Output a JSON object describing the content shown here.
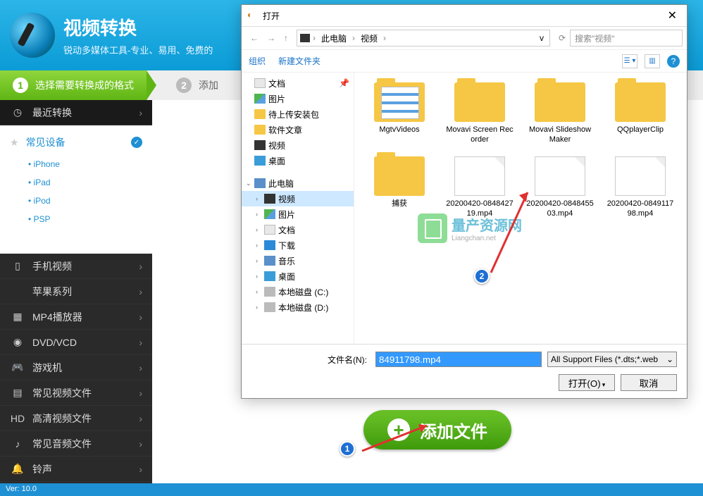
{
  "header": {
    "title": "视频转换",
    "subtitle": "锐动多媒体工具-专业、易用、免费的"
  },
  "steps": {
    "s1": "选择需要转换成的格式",
    "s2": "添加"
  },
  "sidebar": {
    "recent": "最近转换",
    "common_devices": "常见设备",
    "devices": [
      "iPhone",
      "iPad",
      "iPod",
      "PSP"
    ],
    "cats": [
      "手机视频",
      "苹果系列",
      "MP4播放器",
      "DVD/VCD",
      "游戏机",
      "常见视频文件",
      "高清视频文件",
      "常见音频文件",
      "铃声"
    ]
  },
  "addfile": "添加文件",
  "version": "Ver: 10.0",
  "dialog": {
    "title": "打开",
    "crumb_pc": "此电脑",
    "crumb_vid": "视频",
    "search_ph": "搜索\"视频\"",
    "organize": "组织",
    "newfolder": "新建文件夹",
    "tree_quick": [
      "文档",
      "图片",
      "待上传安装包",
      "软件文章",
      "视频",
      "桌面"
    ],
    "tree_pc": "此电脑",
    "tree_pcitems": [
      "视频",
      "图片",
      "文档",
      "下载",
      "音乐",
      "桌面",
      "本地磁盘 (C:)",
      "本地磁盘 (D:)"
    ],
    "files": [
      {
        "name": "MgtvVideos",
        "type": "folder-film"
      },
      {
        "name": "Movavi Screen Recorder",
        "type": "folder"
      },
      {
        "name": "Movavi Slideshow Maker",
        "type": "folder"
      },
      {
        "name": "QQplayerClip",
        "type": "folder"
      },
      {
        "name": "捕获",
        "type": "folder"
      },
      {
        "name": "20200420-084842719.mp4",
        "type": "file"
      },
      {
        "name": "20200420-084845503.mp4",
        "type": "file"
      },
      {
        "name": "20200420-084911798.mp4",
        "type": "file"
      }
    ],
    "filename_label": "文件名(N):",
    "filename_value": "84911798.mp4",
    "filter": "All Support Files (*.dts;*.web",
    "open_btn": "打开(O)",
    "cancel_btn": "取消"
  },
  "watermark": {
    "text": "量产资源网",
    "sub": "Liangchan.net"
  },
  "annotations": {
    "b1": "1",
    "b2": "2"
  }
}
